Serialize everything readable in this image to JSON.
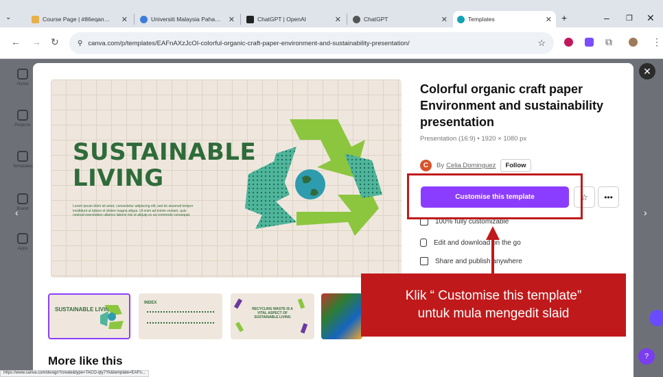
{
  "browser": {
    "tabs": [
      {
        "label": "Course Page | #86eqan…",
        "color": "#e8b04a"
      },
      {
        "label": "Universiti Malaysia Paha…",
        "color": "#3c7dd8"
      },
      {
        "label": "ChatGPT | OpenAI",
        "color": "#222"
      },
      {
        "label": "ChatGPT",
        "color": "#555"
      },
      {
        "label": "Templates",
        "color": "#13a3b4"
      }
    ],
    "new_tab": "+",
    "url": "canva.com/p/templates/EAFnAXzJcOI-colorful-organic-craft-paper-environment-and-sustainability-presentation/",
    "status_url": "https://www.canva.com/design?create&type=TACO-qty7Yk&template=EAFn..."
  },
  "preview": {
    "headline": [
      "SUSTAINABLE",
      "LIVING"
    ],
    "lorem": "Lorem ipsum dolor sit amet, consectetur adipiscing elit, sed do eiusmod tempor incididunt ut labore et dolore magna aliqua. Ut enim ad minim veniam, quis nostrud exercitation ullamco laboris nisi ut aliquip ex ea commodo consequat."
  },
  "thumbnails": [
    {
      "title": "SUSTAINABLE LIVING"
    },
    {
      "title": "INDEX"
    },
    {
      "title": "RECYCLING WASTE IS A VITAL ASPECT OF SUSTAINABLE LIVING"
    }
  ],
  "more_like_this": "More like this",
  "template": {
    "title": "Colorful organic craft paper Environment and sustainability presentation",
    "meta": "Presentation (16:9) • 1920 × 1080 px",
    "author_prefix": "By",
    "author": "Celia Dominguez",
    "author_initial": "C",
    "follow": "Follow",
    "cta": "Customise this template",
    "features": [
      "100% fully customizable",
      "Edit and download on the go",
      "Share and publish anywhere"
    ]
  },
  "annotation": {
    "line1": "Klik “ Customise this template”",
    "line2": "untuk mula mengedit slaid"
  },
  "sidebar": [
    "Home",
    "Projects",
    "Templates",
    "Brand",
    "Apps"
  ],
  "colors": {
    "accent": "#8b3dff",
    "annotation": "#c0191b",
    "slide_green": "#2f6b3a"
  }
}
